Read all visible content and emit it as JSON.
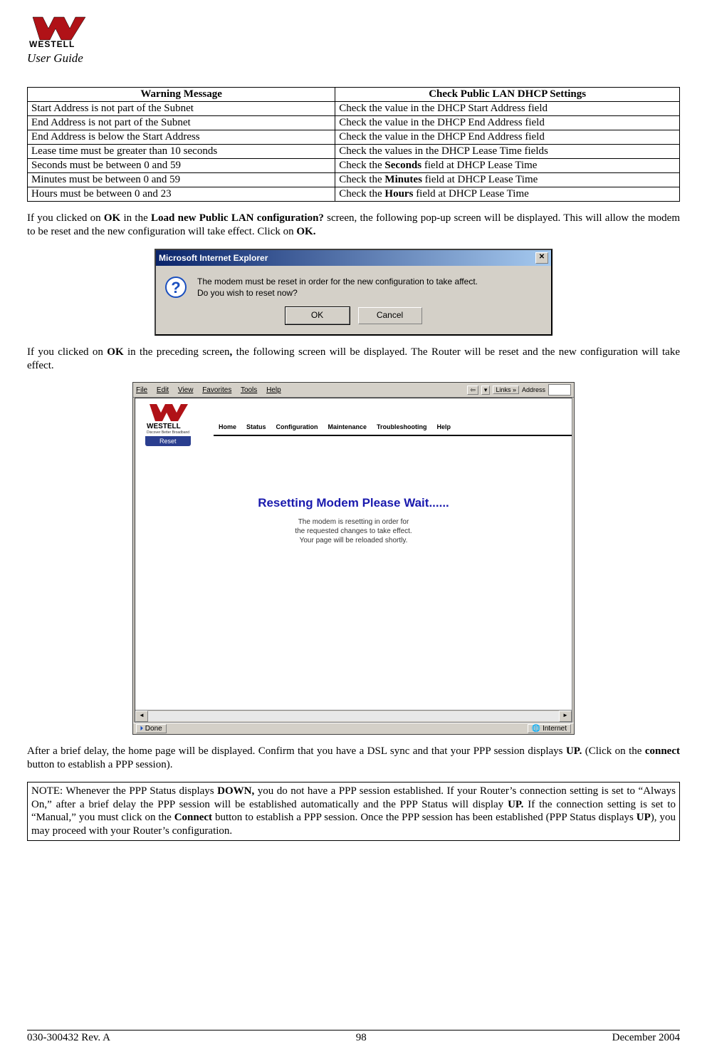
{
  "header": {
    "brand": "WESTELL",
    "subtitle": "User Guide"
  },
  "table": {
    "col1_header": "Warning Message",
    "col2_header": "Check Public LAN DHCP Settings",
    "rows": [
      {
        "msg": "Start Address is not part of the Subnet",
        "check": "Check the value in the DHCP Start Address field"
      },
      {
        "msg": "End Address is not part of the Subnet",
        "check": "Check the value in the DHCP End Address field"
      },
      {
        "msg": "End Address is below the Start Address",
        "check": "Check the value in the DHCP End Address field"
      },
      {
        "msg": "Lease time must be greater than 10 seconds",
        "check": "Check the values in the DHCP Lease Time fields"
      },
      {
        "msg": "Seconds must be between 0 and 59",
        "check_pre": "Check the ",
        "check_bold": "Seconds",
        "check_post": " field at DHCP Lease Time"
      },
      {
        "msg": "Minutes must be between 0 and 59",
        "check_pre": "Check the ",
        "check_bold": "Minutes",
        "check_post": " field at DHCP Lease Time"
      },
      {
        "msg": "Hours must be between 0 and 23",
        "check_pre": "Check the ",
        "check_bold": "Hours",
        "check_post": " field at DHCP Lease Time"
      }
    ]
  },
  "para1": {
    "t1": "If you clicked on ",
    "b1": "OK",
    "t2": " in the ",
    "b2": "Load new Public LAN configuration?",
    "t3": " screen, the following pop-up screen will be displayed. This will allow the modem to be reset and the new configuration will take effect. Click on ",
    "b3": "OK."
  },
  "dialog": {
    "title": "Microsoft Internet Explorer",
    "close": "✕",
    "line1": "The modem must be reset in order for the new configuration to take affect.",
    "line2": "Do you wish to reset now?",
    "ok": "OK",
    "cancel": "Cancel"
  },
  "para2": {
    "t1": "If you clicked on ",
    "b1": "OK",
    "t2": " in the preceding screen",
    "b2": ",",
    "t3": " the following screen will be displayed. The Router will be reset and the new configuration will take effect."
  },
  "browser": {
    "menu": {
      "file": "File",
      "edit": "Edit",
      "view": "View",
      "fav": "Favorites",
      "tools": "Tools",
      "help": "Help"
    },
    "toolbar": {
      "back_glyph": "⇦",
      "links": "Links",
      "addr": "Address"
    },
    "logo_brand": "WESTELL",
    "logo_tag": "Discover Better Broadband",
    "tabs": {
      "home": "Home",
      "status": "Status",
      "config": "Configuration",
      "maint": "Maintenance",
      "trouble": "Troubleshooting",
      "help": "Help"
    },
    "subtab": "Reset",
    "heading": "Resetting Modem Please Wait......",
    "line1": "The modem is resetting in order for",
    "line2": "the requested changes to take effect.",
    "line3": "Your page will be reloaded shortly.",
    "scroll_left": "◄",
    "scroll_right": "►",
    "status_done": "Done",
    "status_zone": "Internet"
  },
  "para3": {
    "t1": "After a brief delay, the home page will be displayed. Confirm that you have a DSL sync and that your PPP session displays ",
    "b1": "UP.",
    "t2": " (Click on the ",
    "b2": "connect",
    "t3": " button to establish a PPP session)."
  },
  "note": {
    "t1": "NOTE: Whenever the PPP Status displays ",
    "b1": "DOWN,",
    "t2": " you do not have a PPP session established. If your Router’s connection setting is set to “Always On,” after a brief delay the PPP session will be established automatically and the PPP Status will display ",
    "b2": "UP.",
    "t3": " If the connection setting is set to “Manual,” you must click on the ",
    "b3": "Connect",
    "t4": " button to establish a PPP session. Once the PPP session has been established (PPP Status displays ",
    "b4": "UP",
    "t5": "), you may proceed with your Router’s configuration."
  },
  "footer": {
    "left": "030-300432 Rev. A",
    "center": "98",
    "right": "December 2004"
  }
}
